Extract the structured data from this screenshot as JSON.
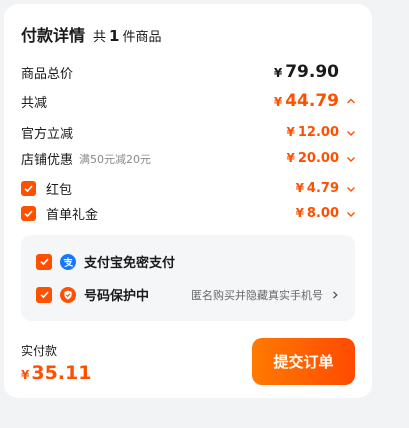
{
  "header": {
    "title": "付款详情",
    "count_prefix": "共",
    "count_value": "1",
    "count_suffix": "件商品"
  },
  "currency_symbol": "¥",
  "price_rows": [
    {
      "label": "商品总价",
      "amount": "79.90"
    },
    {
      "label": "共减",
      "amount": "44.79"
    },
    {
      "label": "官方立减",
      "amount": "12.00"
    },
    {
      "label": "店铺优惠",
      "note": "满50元减20元",
      "amount": "20.00"
    },
    {
      "label": "红包",
      "amount": "4.79",
      "checked": true
    },
    {
      "label": "首单礼金",
      "amount": "8.00",
      "checked": true
    }
  ],
  "services": [
    {
      "label": "支付宝免密支付",
      "checked": true,
      "icon": "alipay-icon"
    },
    {
      "label": "号码保护中",
      "description": "匿名购买并隐藏真实手机号",
      "checked": true,
      "icon": "shield-icon"
    }
  ],
  "footer": {
    "paid_label": "实付款",
    "paid_amount": "35.11",
    "submit_label": "提交订单"
  },
  "colors": {
    "accent": "#ff5000",
    "alipay": "#1677ff",
    "background": "#f2f3f5",
    "service_box": "#f5f6f8"
  }
}
